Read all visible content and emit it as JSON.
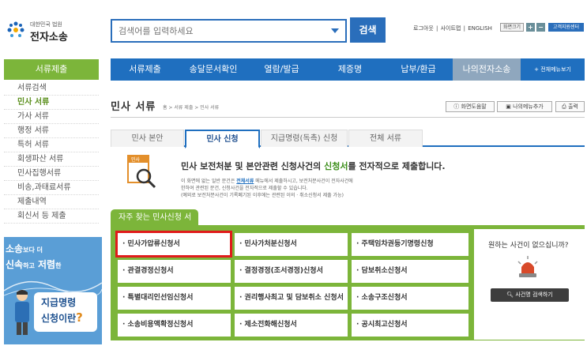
{
  "logo": {
    "small": "대한민국 법원",
    "big": "전자소송"
  },
  "search": {
    "placeholder": "검색어를 입력하세요",
    "button": "검색"
  },
  "util": {
    "logout": "로그아웃",
    "sitemap": "사이트맵",
    "english": "ENGLISH",
    "font_label": "화면크기",
    "plus": "+",
    "minus": "−",
    "center": "고객지원센터"
  },
  "topnav": {
    "items": [
      "서류제출",
      "송달문서확인",
      "열람/발급",
      "제증명",
      "납부/환급",
      "나의전자소송",
      "+ 전체메뉴보기"
    ]
  },
  "sidebar": {
    "title": "서류제출",
    "items": [
      "서류검색",
      "민사 서류",
      "가사 서류",
      "행정 서류",
      "특허 서류",
      "회생파산 서류",
      "민사집행서류",
      "비송,과태료서류",
      "제출내역",
      "회신서 등 제출"
    ]
  },
  "banner": {
    "line1a": "소송",
    "line1b": "보다 더",
    "line2a": "신속",
    "line2b": "하고",
    "line2c": "저렴",
    "line2d": "한",
    "card1": "지급명령",
    "card2a": "신청이란",
    "card2b": "?"
  },
  "page": {
    "title": "민사 서류",
    "breadcrumb": "홈 > 서류 제출 > 민사 서류",
    "help": "화면도움말",
    "add_menu": "나의메뉴추가",
    "print": "출력"
  },
  "tabs": [
    "민사 본안",
    "민사 신청",
    "지급명령(독촉) 신청",
    "전체 서류"
  ],
  "intro": {
    "icon_label": "민사",
    "pre": "민사 보전처분 및 본안관련 신청사건의 ",
    "highlight": "신청서",
    "post": "를 전자적으로 제출합니다.",
    "d1a": "이 화면에 없는 일반 문건은 ",
    "d1link": "전체서류",
    "d1b": " 메뉴에서 제출하시고, 보전처분사건이 전자사건에",
    "d2": "한하여 관련된 문건, 신청사건을 전자적으로 제출할 수 있습니다.",
    "d3": "(예외로 보전처분사건이 기록폐기된 이후에는 관련된 이의 · 취소신청서 제출 가능)"
  },
  "favorites": {
    "title": "자주 찾는 민사신청 서류",
    "rows": [
      [
        "· 민사가압류신청서",
        "· 민사가처분신청서",
        "· 주택임차권등기명령신청"
      ],
      [
        "· 관결경정신청서",
        "· 결정경정(조서경정)신청서",
        "· 담보취소신청서"
      ],
      [
        "· 특별대리인선임신청서",
        "· 권리행사최고 및 담보취소 신청서",
        "· 소송구조신청서"
      ],
      [
        "· 소송비용액확정신청서",
        "· 제소전화해신청서",
        "· 공시최고신청서"
      ]
    ],
    "help_q": "원하는 사건이 없으십니까?",
    "case_search": "사건명 검색하기"
  }
}
